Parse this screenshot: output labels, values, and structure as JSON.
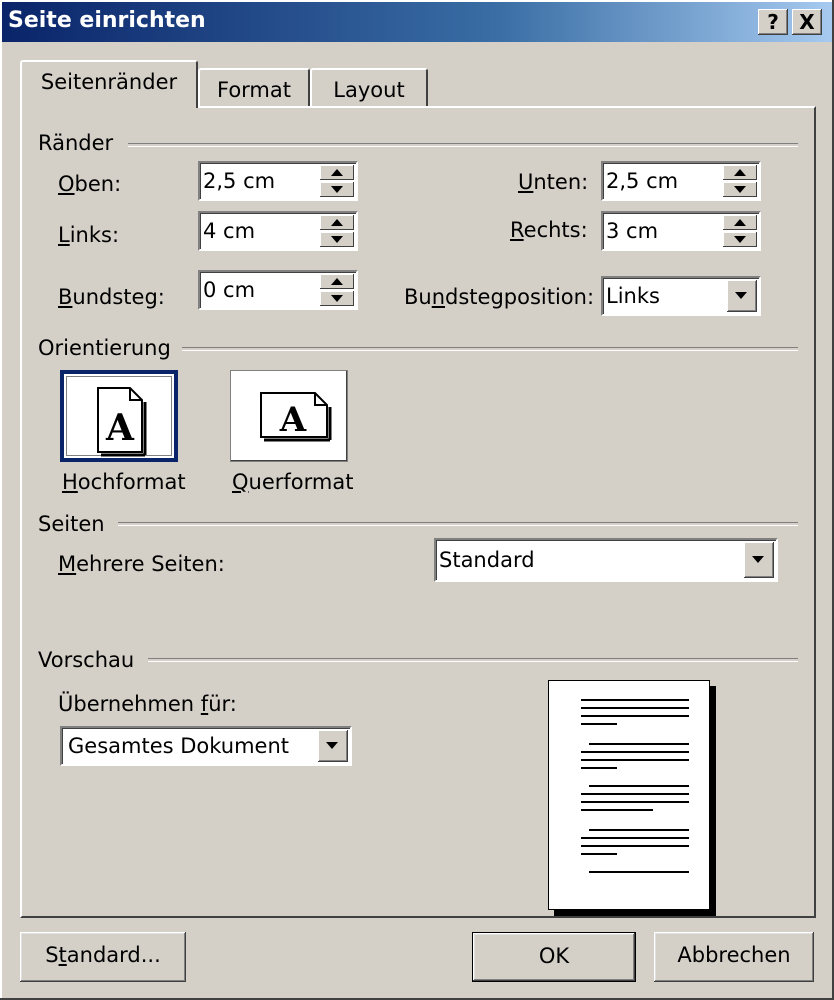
{
  "window": {
    "title": "Seite einrichten",
    "help_label": "?",
    "close_label": "X"
  },
  "tabs": [
    {
      "label": "Seitenränder",
      "active": true
    },
    {
      "label": "Format",
      "active": false
    },
    {
      "label": "Layout",
      "active": false
    }
  ],
  "margins": {
    "group_label": "Ränder",
    "top": {
      "label_u": "O",
      "label_rest": "ben:",
      "value": "2,5 cm"
    },
    "left": {
      "label_u": "L",
      "label_rest": "inks:",
      "value": "4 cm"
    },
    "gutter": {
      "label_u": "B",
      "label_rest": "undsteg:",
      "value": "0 cm"
    },
    "bottom": {
      "label_u": "U",
      "label_rest": "nten:",
      "value": "2,5 cm"
    },
    "right": {
      "label_u": "R",
      "label_rest": "echts:",
      "value": "3 cm"
    },
    "gutter_position": {
      "label_pre": "Bu",
      "label_u": "n",
      "label_rest": "dstegposition:",
      "value": "Links"
    }
  },
  "orientation": {
    "group_label": "Orientierung",
    "portrait": {
      "label_u": "H",
      "label_rest": "ochformat",
      "glyph": "A",
      "selected": true
    },
    "landscape": {
      "label_u": "Q",
      "label_rest": "uerformat",
      "glyph": "A",
      "selected": false
    }
  },
  "pages": {
    "group_label": "Seiten",
    "multiple": {
      "label_u": "M",
      "label_rest": "ehrere Seiten:",
      "value": "Standard"
    }
  },
  "preview": {
    "group_label": "Vorschau",
    "apply_to": {
      "label_pre": "Übernehmen ",
      "label_u": "f",
      "label_rest": "ür:",
      "value": "Gesamtes Dokument"
    }
  },
  "buttons": {
    "default": {
      "label_pre": "S",
      "label_u": "t",
      "label_rest": "andard..."
    },
    "ok": "OK",
    "cancel": "Abbrechen"
  },
  "colors": {
    "titlebar_start": "#0a246a",
    "face": "#d4d0c8",
    "selection_border": "#0a246a"
  }
}
